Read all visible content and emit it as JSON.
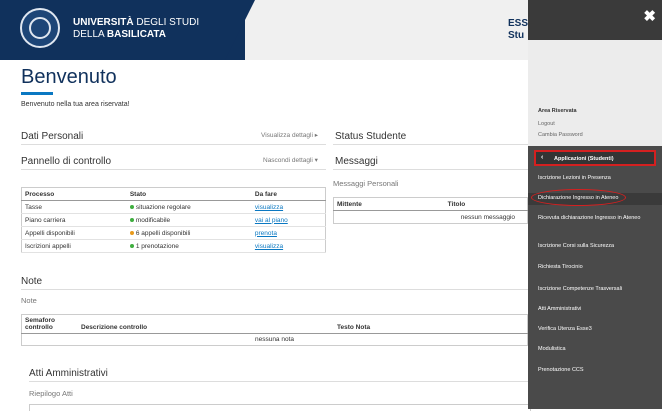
{
  "header": {
    "brand_line1_bold": "UNIVERSITÀ",
    "brand_line1_rest": " DEGLI STUDI",
    "brand_line2_pre": "DELLA ",
    "brand_line2_bold": "BASILICATA",
    "user_line1": "ESS",
    "user_line2": "Stu"
  },
  "page": {
    "title": "Benvenuto",
    "welcome": "Benvenuto nella tua area riservata!"
  },
  "dati_personali": {
    "title": "Dati Personali",
    "link": "Visualizza dettagli"
  },
  "pannello": {
    "title": "Pannello di controllo",
    "link": "Nascondi dettagli"
  },
  "status_studente": {
    "title": "Status Studente"
  },
  "messaggi": {
    "title": "Messaggi",
    "subtitle": "Messaggi Personali",
    "columns": [
      "Mittente",
      "Titolo"
    ],
    "empty": "nessun messaggio"
  },
  "processi": {
    "columns": [
      "Processo",
      "Stato",
      "Da fare"
    ],
    "rows": [
      {
        "processo": "Tasse",
        "stato": "situazione regolare",
        "color": "#3fae3f",
        "azione": "visualizza"
      },
      {
        "processo": "Piano carriera",
        "stato": "modificabile",
        "color": "#3fae3f",
        "azione": "vai al piano"
      },
      {
        "processo": "Appelli disponibili",
        "stato": "6 appelli disponibili",
        "color": "#e89a1c",
        "azione": "prenota"
      },
      {
        "processo": "Iscrizioni appelli",
        "stato": "1 prenotazione",
        "color": "#3fae3f",
        "azione": "visualizza"
      }
    ]
  },
  "note": {
    "title": "Note",
    "subtitle": "Note",
    "columns": [
      "Semaforo controllo",
      "Descrizione controllo",
      "Testo Nota"
    ],
    "empty": "nessuna nota"
  },
  "atti": {
    "title": "Atti Amministrativi",
    "subtitle": "Riepilogo Atti"
  },
  "panel": {
    "close": "✖",
    "area_title": "Area Riservata",
    "logout": "Logout",
    "cambia_password": "Cambia Password",
    "app_chevron": "‹",
    "app_header": "Applicazioni (Studenti)",
    "items": [
      "Iscrizione Lezioni in Presenza",
      "Dichiarazione Ingresso in Ateneo",
      "Ricevuta dichiarazione Ingresso in Ateneo",
      "Iscrizione Corsi sulla Sicurezza",
      "Richiesta Tirocinio",
      "Iscrizione Competenze Trasversali",
      "Atti Amministrativi",
      "Verifica Utenza Esse3",
      "Modulistica",
      "Prenotazione CCS"
    ]
  }
}
